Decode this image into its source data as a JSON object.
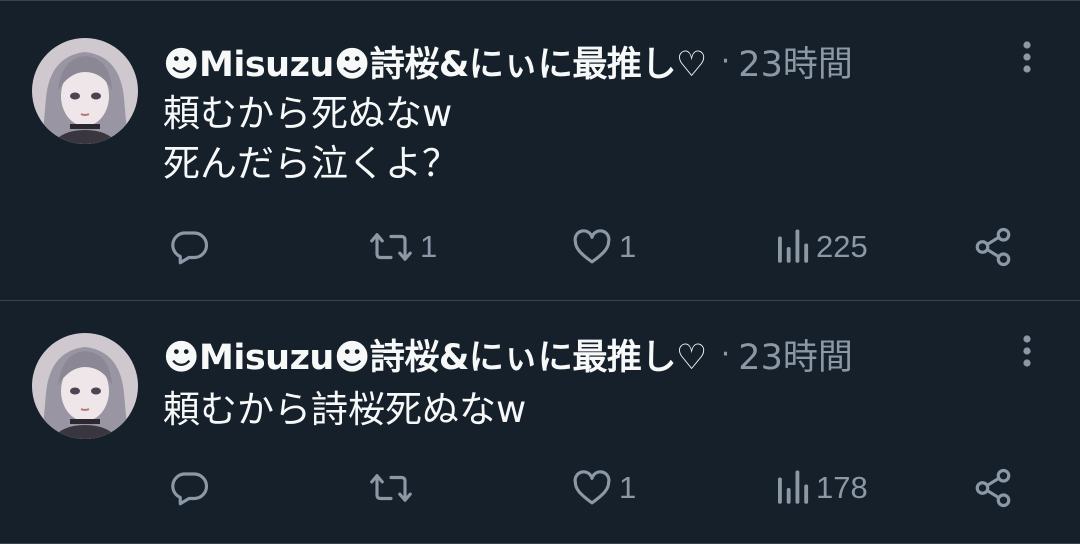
{
  "colors": {
    "background": "#15202b",
    "divider": "#38444d",
    "text": "#f7f9f9",
    "muted": "#8b98a5"
  },
  "tweets": [
    {
      "author": "☻Misuzu☻詩桜&にぃに最推し♡",
      "separator": "·",
      "time": "23時間",
      "text": "頼むから死ぬなw\n死んだら泣くよ？",
      "reply_count": "",
      "retweet_count": "1",
      "like_count": "1",
      "view_count": "225",
      "icons": [
        "reply-icon",
        "retweet-icon",
        "heart-icon",
        "views-icon",
        "share-icon",
        "more-icon"
      ]
    },
    {
      "author": "☻Misuzu☻詩桜&にぃに最推し♡",
      "separator": "·",
      "time": "23時間",
      "text": "頼むから詩桜死ぬなw",
      "reply_count": "",
      "retweet_count": "",
      "like_count": "1",
      "view_count": "178",
      "icons": [
        "reply-icon",
        "retweet-icon",
        "heart-icon",
        "views-icon",
        "share-icon",
        "more-icon"
      ]
    }
  ]
}
